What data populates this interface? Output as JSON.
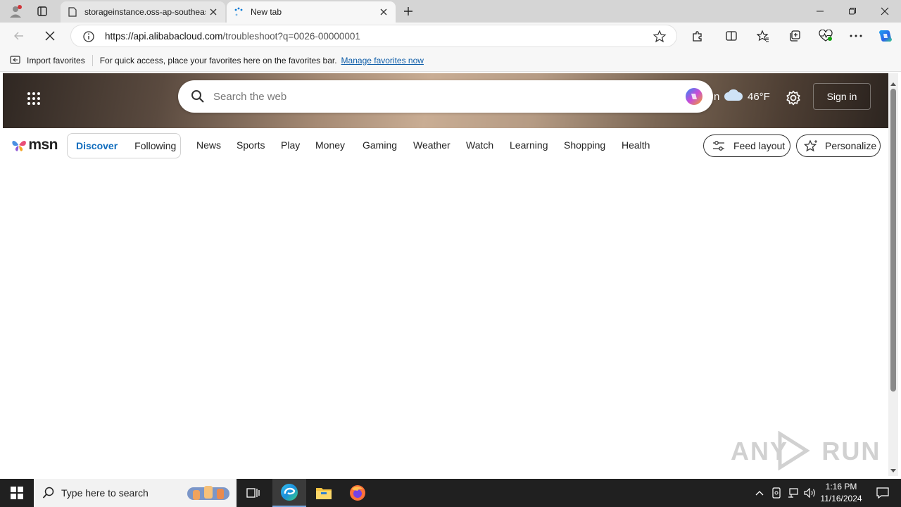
{
  "browser": {
    "tabs": [
      {
        "label": "storageinstance.oss-ap-southeast"
      },
      {
        "label": "New tab"
      }
    ],
    "address": {
      "url_host": "https://api.alibabacloud.com",
      "url_path": "/troubleshoot?q=0026-00000001"
    },
    "favorites_bar": {
      "import_label": "Import favorites",
      "hint": "For quick access, place your favorites here on the favorites bar.",
      "manage_link": "Manage favorites now"
    }
  },
  "msn": {
    "search_placeholder": "Search the web",
    "weather_city_fragment": "n",
    "weather_temp": "46°F",
    "sign_in_label": "Sign in",
    "logo_text": "msn",
    "feed_toggle": {
      "active": "Discover",
      "inactive": "Following"
    },
    "nav_items": [
      "News",
      "Sports",
      "Play",
      "Money",
      "Gaming",
      "Weather",
      "Watch",
      "Learning",
      "Shopping",
      "Health"
    ],
    "feed_layout_label": "Feed layout",
    "personalize_label": "Personalize"
  },
  "taskbar": {
    "search_placeholder": "Type here to search",
    "time": "1:16 PM",
    "date": "11/16/2024"
  },
  "watermark": {
    "text": "ANY RUN"
  },
  "colors": {
    "accent": "#0f6cbd",
    "taskbar": "#202020",
    "edge_blue": "#0078d4"
  }
}
